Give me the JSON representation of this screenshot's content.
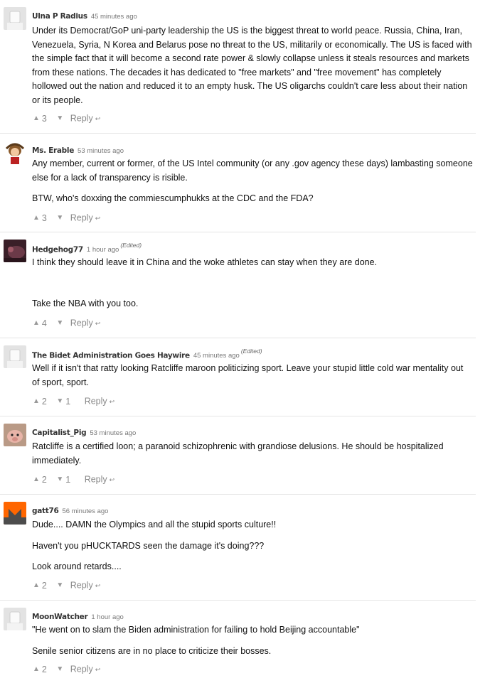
{
  "comments": [
    {
      "author": "Ulna P Radius",
      "time": "45 minutes ago",
      "edited": "",
      "paragraphs": [
        "Under its Democrat/GoP uni-party leadership the US is the biggest threat to world peace. Russia, China, Iran, Venezuela, Syria, N Korea and Belarus pose no threat to the US, militarily or economically. The US is faced with the simple fact that it will become a second rate power & slowly collapse unless it steals resources and markets from these nations. The decades it has dedicated to \"free markets\" and \"free movement\" has completely hollowed out the nation and reduced it to an empty husk. The US oligarchs couldn't care less about their nation or its people."
      ],
      "upvotes": "3",
      "downvotes": "",
      "reply_label": "Reply"
    },
    {
      "author": "Ms. Erable",
      "time": "53 minutes ago",
      "edited": "",
      "paragraphs": [
        "Any member, current or former, of the US Intel community (or any .gov agency these days) lambasting someone else for a lack of transparency is risible.",
        "BTW, who's doxxing the commiescumphukks at the CDC and the FDA?"
      ],
      "upvotes": "3",
      "downvotes": "",
      "reply_label": "Reply"
    },
    {
      "author": "Hedgehog77",
      "time": "1 hour ago",
      "edited": "(Edited)",
      "paragraphs": [
        "I think they should leave it in China and the woke athletes can stay when they are done.",
        "",
        "Take the NBA with you too."
      ],
      "upvotes": "4",
      "downvotes": "",
      "reply_label": "Reply"
    },
    {
      "author": "The Bidet Administration Goes Haywire",
      "time": "45 minutes ago",
      "edited": "(Edited)",
      "paragraphs": [
        "Well if it isn't that ratty looking Ratcliffe maroon politicizing sport. Leave your stupid little cold war mentality out of sport, sport."
      ],
      "upvotes": "2",
      "downvotes": "1",
      "reply_label": "Reply"
    },
    {
      "author": "Capitalist_Pig",
      "time": "53 minutes ago",
      "edited": "",
      "paragraphs": [
        "Ratcliffe is a certified loon; a paranoid schizophrenic with grandiose delusions. He should be hospitalized immediately."
      ],
      "upvotes": "2",
      "downvotes": "1",
      "reply_label": "Reply"
    },
    {
      "author": "gatt76",
      "time": "56 minutes ago",
      "edited": "",
      "paragraphs": [
        "Dude.... DAMN the Olympics and all the stupid sports culture!!",
        "Haven't you pHUCKTARDS seen the damage it's doing???",
        "Look around retards...."
      ],
      "upvotes": "2",
      "downvotes": "",
      "reply_label": "Reply"
    },
    {
      "author": "MoonWatcher",
      "time": "1 hour ago",
      "edited": "",
      "paragraphs": [
        "\"He went on to slam the Biden administration for failing to hold Beijing accountable\"",
        "Senile senior citizens are in no place to criticize their bosses."
      ],
      "upvotes": "2",
      "downvotes": "",
      "reply_label": "Reply"
    }
  ]
}
